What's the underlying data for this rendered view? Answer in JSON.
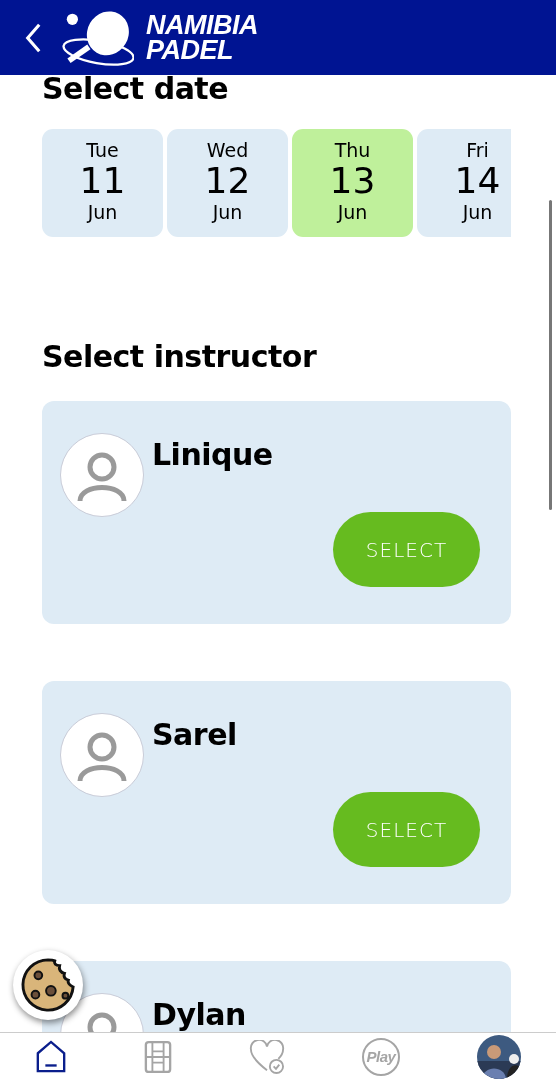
{
  "header": {
    "logo_lines": [
      "NAMIBIA",
      "PADEL"
    ]
  },
  "date_section": {
    "title": "Select date",
    "dates": [
      {
        "weekday": "Tue",
        "day": "11",
        "month": "Jun",
        "selected": false
      },
      {
        "weekday": "Wed",
        "day": "12",
        "month": "Jun",
        "selected": false
      },
      {
        "weekday": "Thu",
        "day": "13",
        "month": "Jun",
        "selected": true
      },
      {
        "weekday": "Fri",
        "day": "14",
        "month": "Jun",
        "selected": false
      }
    ]
  },
  "instructor_section": {
    "title": "Select instructor",
    "instructors": [
      {
        "name": "Linique",
        "button": "SELECT"
      },
      {
        "name": "Sarel",
        "button": "SELECT"
      },
      {
        "name": "Dylan"
      }
    ]
  },
  "bottom_nav": [
    {
      "kind": "home",
      "selected": true
    },
    {
      "kind": "calendar",
      "selected": false
    },
    {
      "kind": "favorites",
      "selected": false
    },
    {
      "kind": "play",
      "label": "Play",
      "selected": false
    },
    {
      "kind": "profile",
      "selected": false
    }
  ]
}
